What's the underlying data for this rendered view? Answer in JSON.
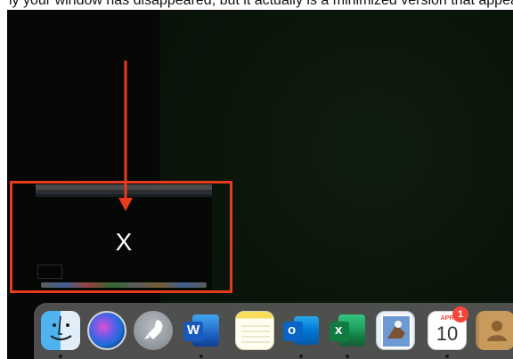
{
  "caption": {
    "text": "ly your window has disappeared, but it actually is a minimized version that appears in the dock. To"
  },
  "minimized_window": {
    "label": "X"
  },
  "colors": {
    "highlight": "#e83a1c",
    "desktop": "#0a160a",
    "dock": "#5a5a5a",
    "badge": "#f4463a"
  },
  "dock": {
    "items": [
      {
        "name": "Finder",
        "icon": "finder-icon"
      },
      {
        "name": "Siri",
        "icon": "siri-icon"
      },
      {
        "name": "Launchpad",
        "icon": "launchpad-icon"
      },
      {
        "name": "Microsoft Word",
        "icon": "word-icon",
        "letter": "W"
      },
      {
        "name": "Notes",
        "icon": "notes-icon"
      },
      {
        "name": "Microsoft Outlook",
        "icon": "outlook-icon",
        "letter": "o"
      },
      {
        "name": "Microsoft Excel",
        "icon": "excel-icon",
        "letter": "x"
      },
      {
        "name": "Preview",
        "icon": "preview-icon"
      },
      {
        "name": "Calendar",
        "icon": "calendar-icon",
        "month": "APR",
        "day": "10",
        "badge": "1"
      },
      {
        "name": "Contacts",
        "icon": "contacts-icon"
      }
    ]
  }
}
